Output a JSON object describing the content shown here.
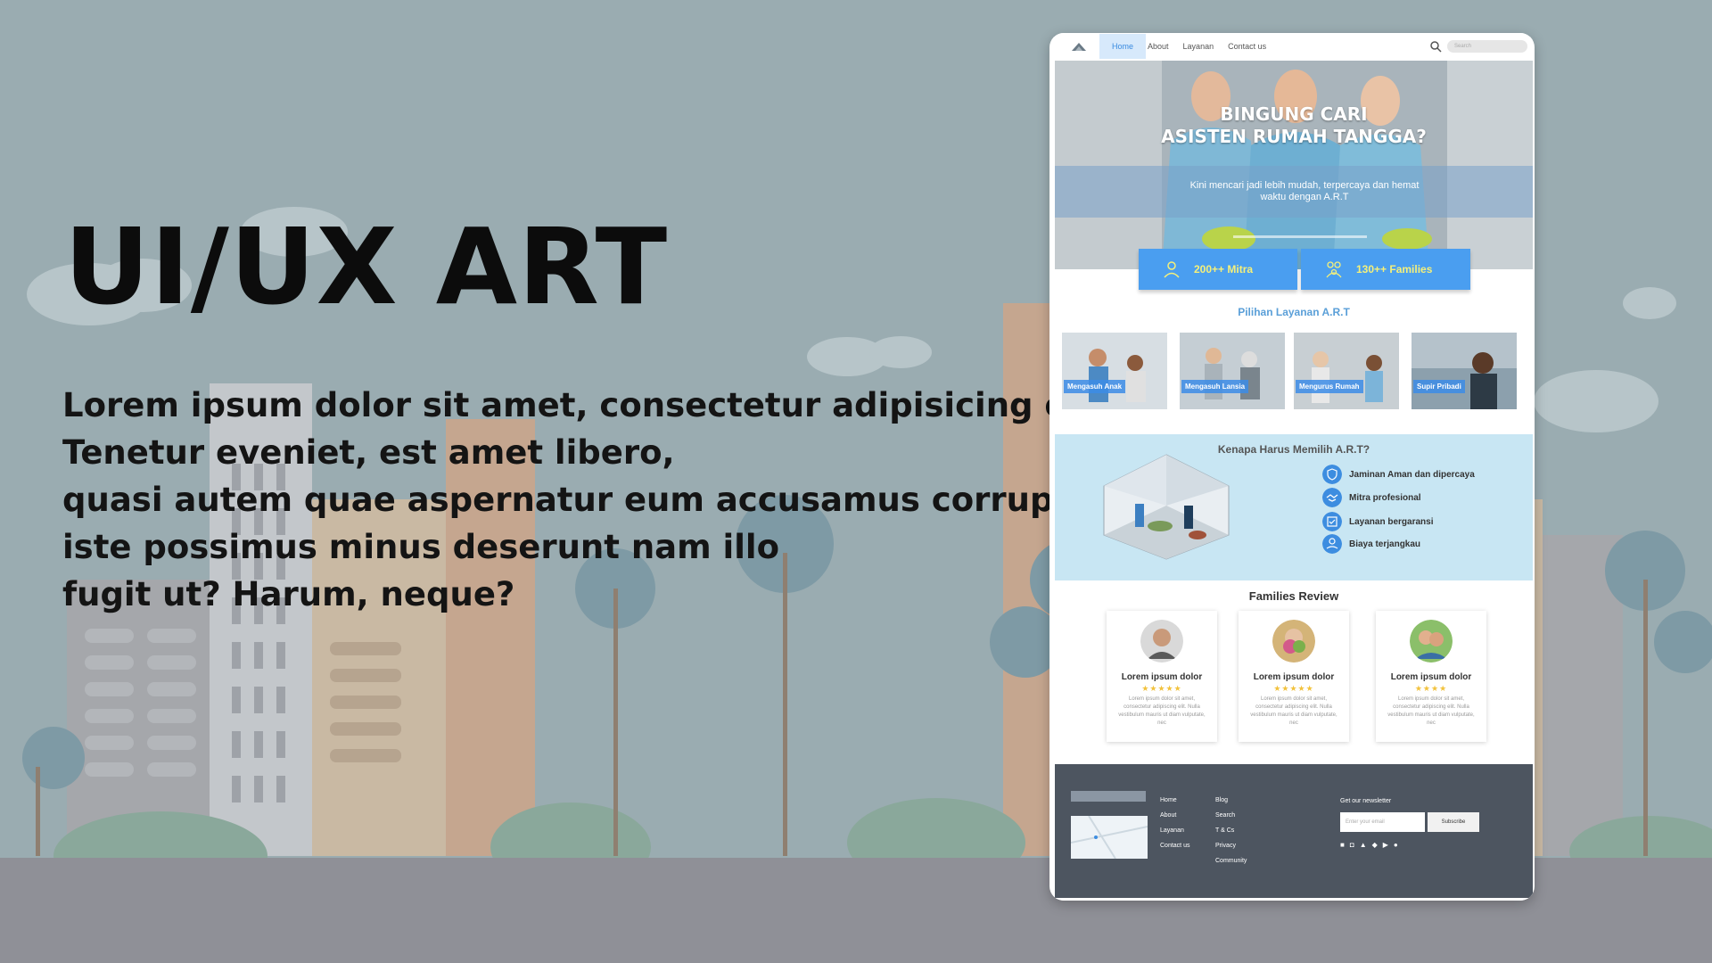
{
  "headline": "UI/UX ART",
  "description_lines": [
    "Lorem ipsum dolor sit amet, consectetur adipisicing elit.",
    "Tenetur eveniet, est amet libero,",
    "quasi autem quae aspernatur eum accusamus corrupti",
    "iste possimus minus deserunt nam illo",
    "fugit ut? Harum, neque?"
  ],
  "mockup": {
    "nav": {
      "items": [
        "Home",
        "About",
        "Layanan",
        "Contact us"
      ],
      "search_placeholder": "Search"
    },
    "hero": {
      "title_line1": "BINGUNG CARI",
      "title_line2": "ASISTEN RUMAH TANGGA?",
      "subtitle": "Kini mencari jadi lebih mudah, terpercaya dan hemat waktu dengan A.R.T"
    },
    "stats": [
      {
        "label": "200++ Mitra",
        "icon": "person-icon"
      },
      {
        "label": "130++ Families",
        "icon": "family-icon"
      }
    ],
    "services_title": "Pilihan Layanan A.R.T",
    "services": [
      "Mengasuh Anak",
      "Mengasuh Lansia",
      "Mengurus Rumah",
      "Supir Pribadi"
    ],
    "why_title": "Kenapa Harus Memilih A.R.T?",
    "why_items": [
      "Jaminan Aman dan dipercaya",
      "Mitra profesional",
      "Layanan bergaransi",
      "Biaya terjangkau"
    ],
    "reviews_title": "Families Review",
    "reviews": [
      {
        "name": "Lorem ipsum dolor",
        "stars": "★★★★★",
        "text": "Lorem ipsum dolor sit amet, consectetur adipiscing elit. Nulla vestibulum mauris ut diam vulputate, nec"
      },
      {
        "name": "Lorem ipsum dolor",
        "stars": "★★★★★",
        "text": "Lorem ipsum dolor sit amet, consectetur adipiscing elit. Nulla vestibulum mauris ut diam vulputate, nec"
      },
      {
        "name": "Lorem ipsum dolor",
        "stars": "★★★★",
        "text": "Lorem ipsum dolor sit amet, consectetur adipiscing elit. Nulla vestibulum mauris ut diam vulputate, nec"
      }
    ],
    "footer": {
      "col1": [
        "Home",
        "About",
        "Layanan",
        "Contact us"
      ],
      "col2": [
        "Blog",
        "Search",
        "T & Cs",
        "Privacy",
        "Community"
      ],
      "newsletter_label": "Get our newsletter",
      "email_placeholder": "Enter your email",
      "subscribe_label": "Subscribe"
    }
  },
  "colors": {
    "accent": "#4a9ef0",
    "why_bg": "#c8e6f3",
    "footer_bg": "#4d5560",
    "stat_text": "#f5f07a"
  }
}
